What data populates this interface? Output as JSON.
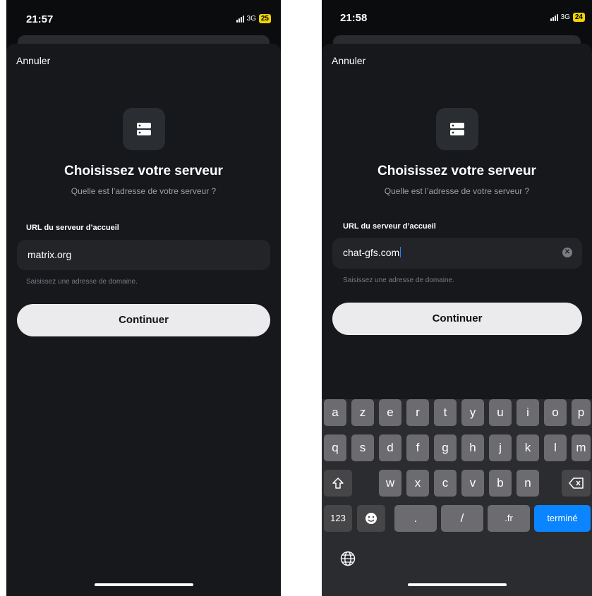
{
  "left": {
    "status": {
      "time": "21:57",
      "network": "3G",
      "battery": "25"
    },
    "cancel": "Annuler",
    "title": "Choisissez votre serveur",
    "subtitle": "Quelle est l’adresse de votre serveur ?",
    "field_label": "URL du serveur d’accueil",
    "field_value": "matrix.org",
    "hint": "Saisissez une adresse de domaine.",
    "continue": "Continuer"
  },
  "right": {
    "status": {
      "time": "21:58",
      "network": "3G",
      "battery": "24"
    },
    "cancel": "Annuler",
    "title": "Choisissez votre serveur",
    "subtitle": "Quelle est l’adresse de votre serveur ?",
    "field_label": "URL du serveur d’accueil",
    "field_value": "chat-gfs.com",
    "hint": "Saisissez une adresse de domaine.",
    "continue": "Continuer"
  },
  "keyboard": {
    "row1": [
      "a",
      "z",
      "e",
      "r",
      "t",
      "y",
      "u",
      "i",
      "o",
      "p"
    ],
    "row2": [
      "q",
      "s",
      "d",
      "f",
      "g",
      "h",
      "j",
      "k",
      "l",
      "m"
    ],
    "row3": [
      "w",
      "x",
      "c",
      "v",
      "b",
      "n"
    ],
    "numbers": "123",
    "dot": ".",
    "slash": "/",
    "fr": ".fr",
    "done": "terminé"
  },
  "icons": {
    "server": "server-icon",
    "clear": "clear-icon",
    "shift": "shift-icon",
    "backspace": "backspace-icon",
    "emoji": "emoji-icon",
    "globe": "globe-icon"
  },
  "colors": {
    "accent": "#0a84ff",
    "background": "#16181b",
    "button": "#ebebee"
  }
}
